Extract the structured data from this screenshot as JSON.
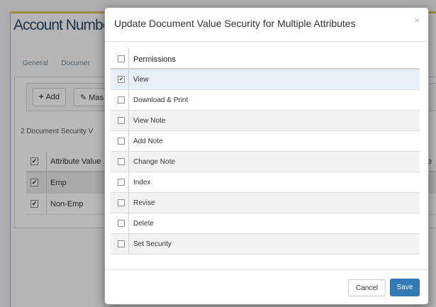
{
  "background": {
    "title": "Account Numbe",
    "tabs": [
      "General",
      "Documer"
    ],
    "toolbar": {
      "add_icon": "+",
      "add_label": "Add",
      "mass_icon": "pencil-icon",
      "mass_label": "Mas"
    },
    "count_text": "2 Document Security V",
    "table": {
      "header": "Attribute Value",
      "rows": [
        "Emp",
        "Non-Emp"
      ]
    },
    "edge_text": "e"
  },
  "modal": {
    "title": "Update Document Value Security for Multiple Attributes",
    "close_icon": "×",
    "header_label": "Permissions",
    "permissions": [
      {
        "label": "View",
        "checked": true
      },
      {
        "label": "Download & Print",
        "checked": false
      },
      {
        "label": "View Note",
        "checked": false
      },
      {
        "label": "Add Note",
        "checked": false
      },
      {
        "label": "Change Note",
        "checked": false
      },
      {
        "label": "Index",
        "checked": false
      },
      {
        "label": "Revise",
        "checked": false
      },
      {
        "label": "Delete",
        "checked": false
      },
      {
        "label": "Set Security",
        "checked": false
      }
    ],
    "cancel_label": "Cancel",
    "save_label": "Save"
  },
  "colors": {
    "primary": "#337ab7",
    "selected_row": "#e9eff8"
  }
}
